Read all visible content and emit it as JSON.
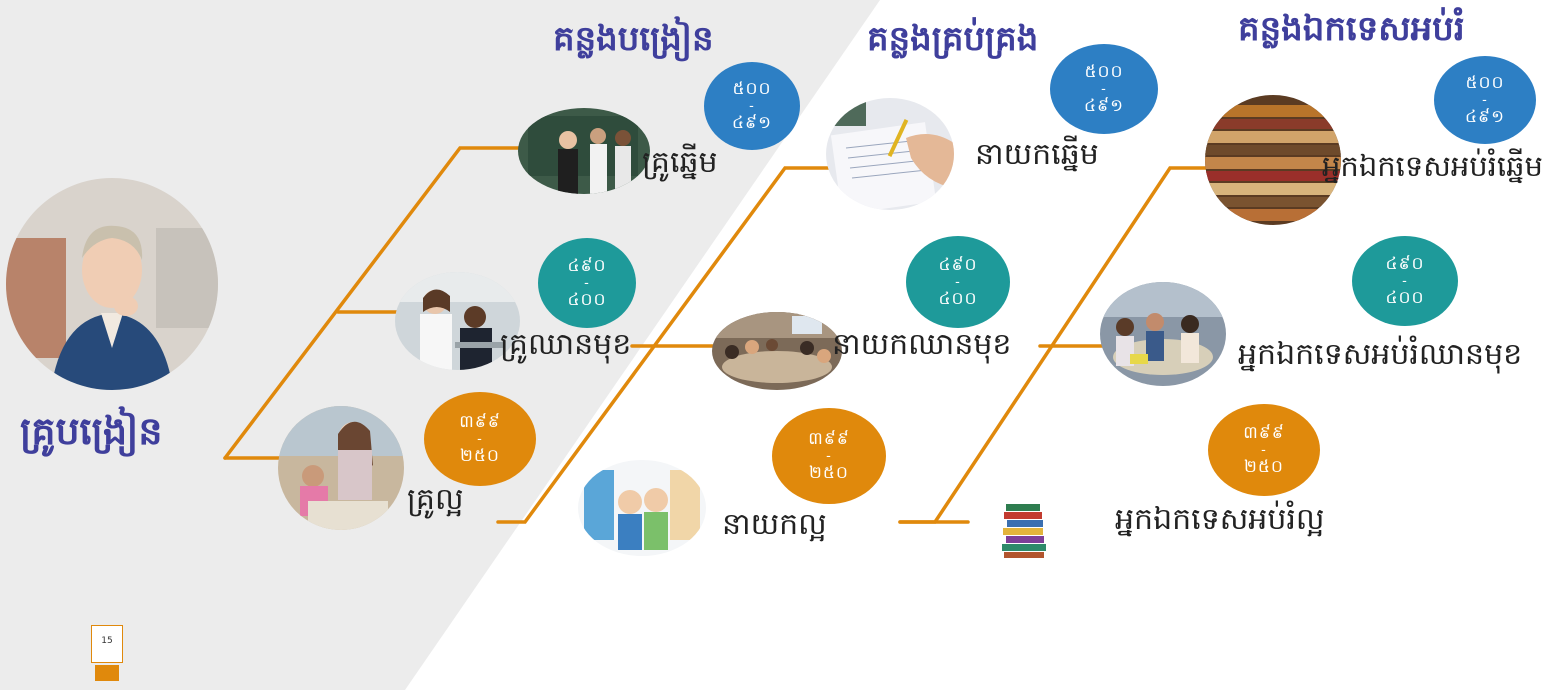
{
  "colors": {
    "accent_orange": "#e0890c",
    "heading_blue": "#3f3f9c",
    "badge_blue": "#2d7fc4",
    "badge_teal": "#1e9a9a",
    "badge_orange": "#e0890c",
    "background_panel": "#ececec"
  },
  "root": {
    "title": "គ្រូបង្រៀន"
  },
  "headings": {
    "teaching": "គន្លងបង្រៀន",
    "management": "គន្លងគ្រប់គ្រង",
    "specialist": "គន្លងឯកទេសអប់រំ"
  },
  "tracks": {
    "teaching": {
      "levels": [
        {
          "label": "គ្រូឆ្នើម",
          "range_top": "៥០០",
          "range_sep": "-",
          "range_bottom": "៤៩១"
        },
        {
          "label": "គ្រូឈានមុខ",
          "range_top": "៤៩០",
          "range_sep": "-",
          "range_bottom": "៤០០"
        },
        {
          "label": "គ្រូល្អ",
          "range_top": "៣៩៩",
          "range_sep": "-",
          "range_bottom": "២៥០"
        }
      ]
    },
    "management": {
      "levels": [
        {
          "label": "នាយកឆ្នើម",
          "range_top": "៥០០",
          "range_sep": "-",
          "range_bottom": "៤៩១"
        },
        {
          "label": "នាយកឈានមុខ",
          "range_top": "៤៩០",
          "range_sep": "-",
          "range_bottom": "៤០០"
        },
        {
          "label": "នាយកល្អ",
          "range_top": "៣៩៩",
          "range_sep": "-",
          "range_bottom": "២៥០"
        }
      ]
    },
    "specialist": {
      "levels": [
        {
          "label": "អ្នកឯកទេសអប់រំឆ្នើម",
          "range_top": "៥០០",
          "range_sep": "-",
          "range_bottom": "៤៩១"
        },
        {
          "label": "អ្នកឯកទេសអប់រំឈានមុខ",
          "range_top": "៤៩០",
          "range_sep": "-",
          "range_bottom": "៤០០"
        },
        {
          "label": "អ្នកឯកទេសអប់រំល្អ",
          "range_top": "៣៩៩",
          "range_sep": "-",
          "range_bottom": "២៥០"
        }
      ]
    }
  },
  "footer": {
    "page_number": "15"
  }
}
